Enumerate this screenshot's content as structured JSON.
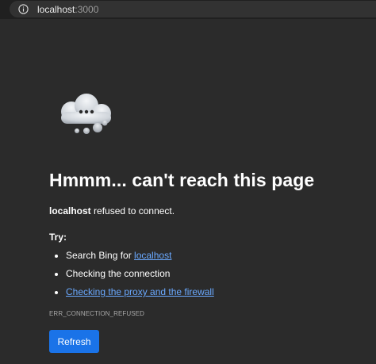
{
  "address_bar": {
    "host": "localhost",
    "port": ":3000",
    "icon": "info-icon"
  },
  "error_page": {
    "illustration": "cloud-icon",
    "title": "Hmmm... can't reach this page",
    "subtitle_host": "localhost",
    "subtitle_rest": " refused to connect.",
    "try_label": "Try:",
    "tips": {
      "search_prefix": "Search Bing for ",
      "search_link": "localhost",
      "check_connection": "Checking the connection",
      "proxy_link": "Checking the proxy and the firewall"
    },
    "error_code": "ERR_CONNECTION_REFUSED",
    "refresh_label": "Refresh"
  },
  "colors": {
    "background": "#2b2b2b",
    "link": "#6aa9ff",
    "button": "#1a73e8"
  }
}
